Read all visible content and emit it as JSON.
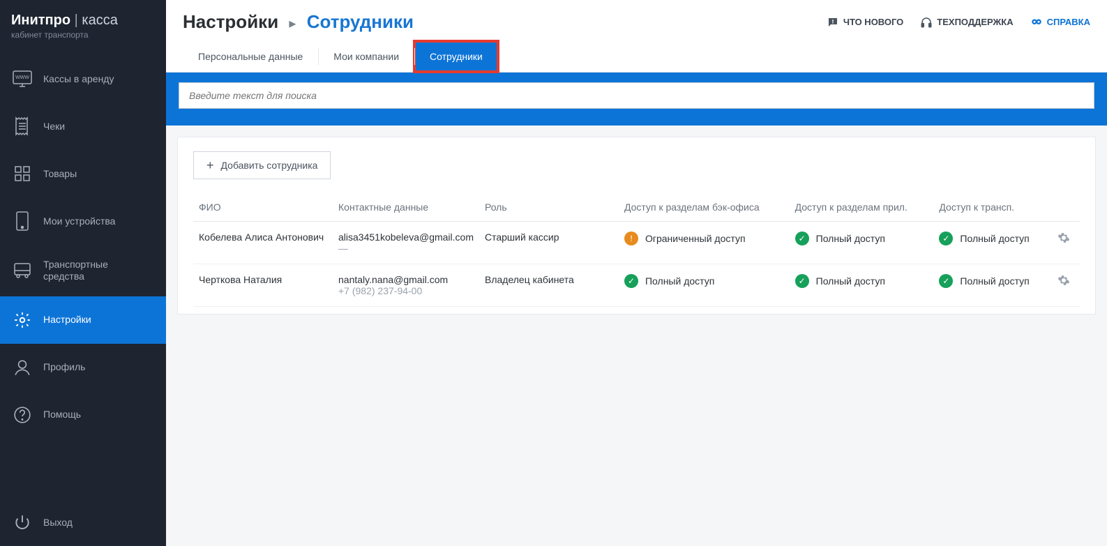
{
  "brand": {
    "name1": "Инитпро",
    "name2": "касса",
    "subtitle": "кабинет транспорта"
  },
  "sidebar": {
    "items": [
      {
        "label": "Кассы в аренду"
      },
      {
        "label": "Чеки"
      },
      {
        "label": "Товары"
      },
      {
        "label": "Мои устройства"
      },
      {
        "label": "Транспортные\nсредства"
      },
      {
        "label": "Настройки"
      },
      {
        "label": "Профиль"
      },
      {
        "label": "Помощь"
      }
    ],
    "exit_label": "Выход"
  },
  "header": {
    "breadcrumb_root": "Настройки",
    "breadcrumb_current": "Сотрудники",
    "whats_new": "ЧТО НОВОГО",
    "support": "ТЕХПОДДЕРЖКА",
    "help": "СПРАВКА"
  },
  "tabs": [
    {
      "label": "Персональные данные"
    },
    {
      "label": "Мои компании"
    },
    {
      "label": "Сотрудники"
    }
  ],
  "search": {
    "placeholder": "Введите текст для поиска"
  },
  "add_button": "Добавить сотрудника",
  "table": {
    "headers": {
      "name": "ФИО",
      "contact": "Контактные данные",
      "role": "Роль",
      "access_back": "Доступ к разделам бэк-офиса",
      "access_app": "Доступ к разделам прил.",
      "access_transp": "Доступ к трансп."
    },
    "rows": [
      {
        "name": "Кобелева Алиса Антонович",
        "email": "alisa3451kobeleva@gmail.com",
        "phone": "—",
        "role": "Старший кассир",
        "access_back": {
          "type": "limited",
          "label": "Ограниченный доступ"
        },
        "access_app": {
          "type": "full",
          "label": "Полный доступ"
        },
        "access_transp": {
          "type": "full",
          "label": "Полный доступ"
        }
      },
      {
        "name": "Черткова Наталия",
        "email": "nantaly.nana@gmail.com",
        "phone": "+7 (982) 237-94-00",
        "role": "Владелец кабинета",
        "access_back": {
          "type": "full",
          "label": "Полный доступ"
        },
        "access_app": {
          "type": "full",
          "label": "Полный доступ"
        },
        "access_transp": {
          "type": "full",
          "label": "Полный доступ"
        }
      }
    ]
  }
}
